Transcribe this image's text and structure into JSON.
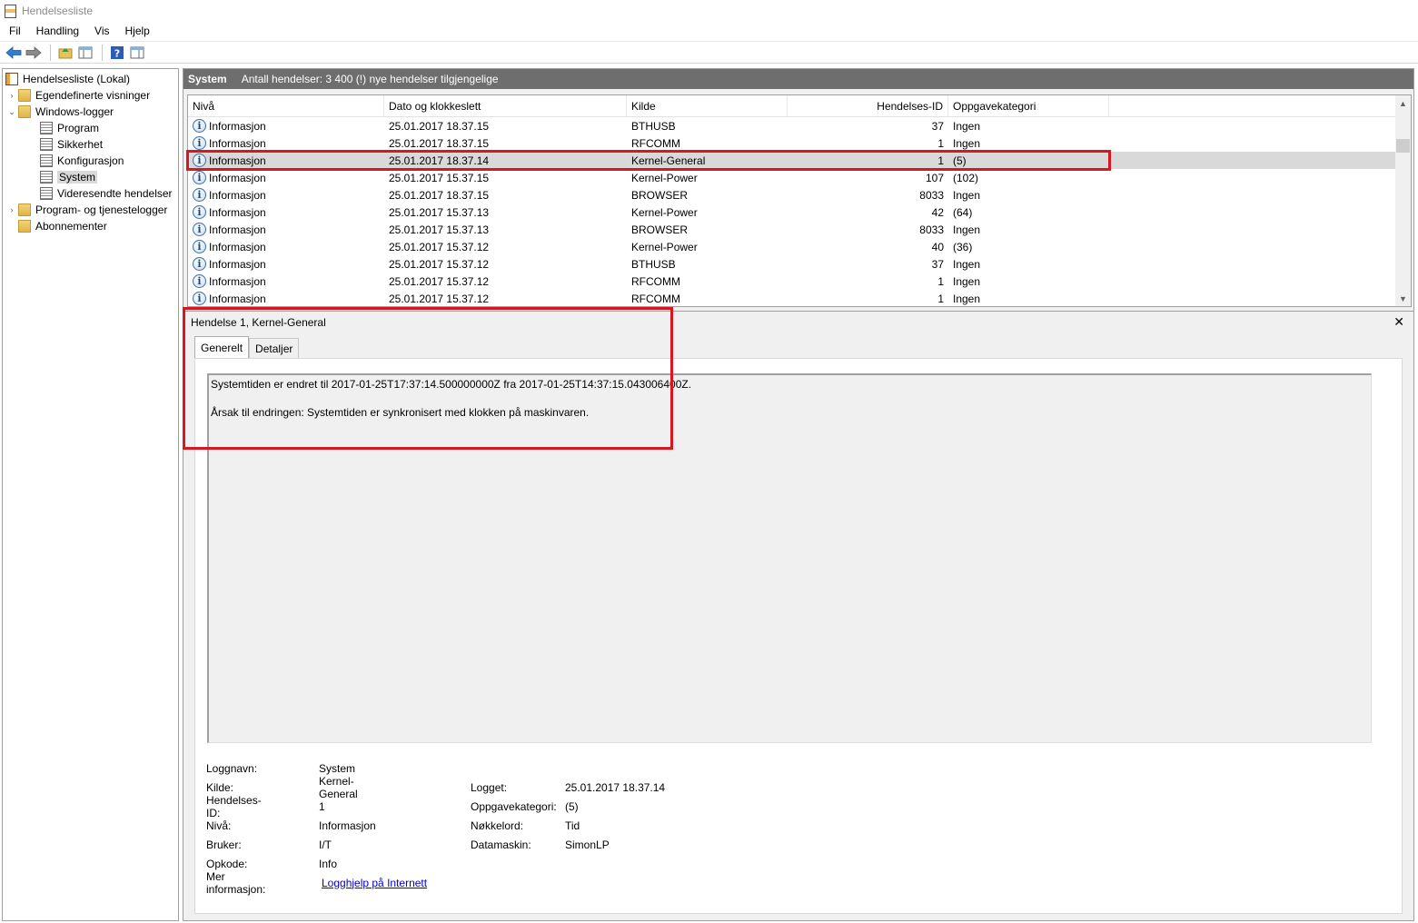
{
  "window": {
    "title": "Hendelsesliste"
  },
  "menu": [
    "Fil",
    "Handling",
    "Vis",
    "Hjelp"
  ],
  "toolbar": {
    "icons": [
      "back-arrow-icon",
      "forward-arrow-icon",
      "folder-up-icon",
      "console-tree-icon",
      "help-icon",
      "action-pane-icon"
    ]
  },
  "tree": {
    "root": "Hendelsesliste (Lokal)",
    "custom_views": "Egendefinerte visninger",
    "windows_logs": "Windows-logger",
    "logs": [
      "Program",
      "Sikkerhet",
      "Konfigurasjon",
      "System",
      "Videresendte hendelser"
    ],
    "selected_log": "System",
    "app_logs": "Program- og tjenestelogger",
    "subscriptions": "Abonnementer"
  },
  "header": {
    "title": "System",
    "summary": "Antall hendelser: 3 400 (!) nye hendelser tilgjengelige"
  },
  "table": {
    "columns": [
      "Nivå",
      "Dato og klokkeslett",
      "Kilde",
      "Hendelses-ID",
      "Oppgavekategori"
    ],
    "rows": [
      {
        "level": "Informasjon",
        "date": "25.01.2017 18.37.15",
        "source": "BTHUSB",
        "id": "37",
        "category": "Ingen"
      },
      {
        "level": "Informasjon",
        "date": "25.01.2017 18.37.15",
        "source": "RFCOMM",
        "id": "1",
        "category": "Ingen"
      },
      {
        "level": "Informasjon",
        "date": "25.01.2017 18.37.14",
        "source": "Kernel-General",
        "id": "1",
        "category": "(5)"
      },
      {
        "level": "Informasjon",
        "date": "25.01.2017 15.37.15",
        "source": "Kernel-Power",
        "id": "107",
        "category": "(102)"
      },
      {
        "level": "Informasjon",
        "date": "25.01.2017 18.37.15",
        "source": "BROWSER",
        "id": "8033",
        "category": "Ingen"
      },
      {
        "level": "Informasjon",
        "date": "25.01.2017 15.37.13",
        "source": "Kernel-Power",
        "id": "42",
        "category": "(64)"
      },
      {
        "level": "Informasjon",
        "date": "25.01.2017 15.37.13",
        "source": "BROWSER",
        "id": "8033",
        "category": "Ingen"
      },
      {
        "level": "Informasjon",
        "date": "25.01.2017 15.37.12",
        "source": "Kernel-Power",
        "id": "40",
        "category": "(36)"
      },
      {
        "level": "Informasjon",
        "date": "25.01.2017 15.37.12",
        "source": "BTHUSB",
        "id": "37",
        "category": "Ingen"
      },
      {
        "level": "Informasjon",
        "date": "25.01.2017 15.37.12",
        "source": "RFCOMM",
        "id": "1",
        "category": "Ingen"
      },
      {
        "level": "Informasjon",
        "date": "25.01.2017 15.37.12",
        "source": "RFCOMM",
        "id": "1",
        "category": "Ingen"
      }
    ],
    "selected_index": 2
  },
  "detail": {
    "title": "Hendelse 1, Kernel-General",
    "close": "✕",
    "tabs": [
      "Generelt",
      "Detaljer"
    ],
    "active_tab": "Generelt",
    "description_line1": "Systemtiden er endret til 2017-01-25T17:37:14.500000000Z fra 2017-01-25T14:37:15.043006400Z.",
    "description_line2": "Årsak til endringen: Systemtiden er synkronisert med klokken på maskinvaren.",
    "props": {
      "log_name_label": "Loggnavn:",
      "log_name": "System",
      "source_label": "Kilde:",
      "source": "Kernel-General",
      "logged_label": "Logget:",
      "logged": "25.01.2017 18.37.14",
      "event_id_label": "Hendelses-ID:",
      "event_id": "1",
      "task_label": "Oppgavekategori:",
      "task": "(5)",
      "level_label": "Nivå:",
      "level": "Informasjon",
      "keywords_label": "Nøkkelord:",
      "keywords": "Tid",
      "user_label": "Bruker:",
      "user": "I/T",
      "computer_label": "Datamaskin:",
      "computer": "SimonLP",
      "opcode_label": "Opkode:",
      "opcode": "Info",
      "more_info_label": "Mer informasjon:",
      "more_info_link": "Logghjelp på Internett"
    }
  },
  "colors": {
    "annotation": "#d81820",
    "header_bg": "#6e6e6e",
    "selection": "#d9d9d9"
  }
}
